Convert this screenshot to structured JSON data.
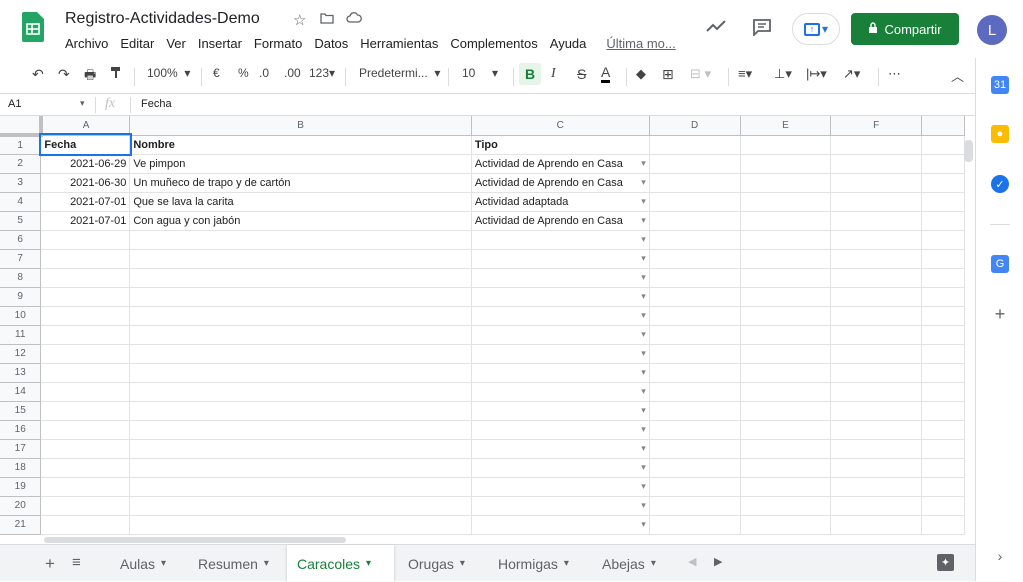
{
  "header": {
    "title": "Registro-Actividades-Demo",
    "menu": [
      "Archivo",
      "Editar",
      "Ver",
      "Insertar",
      "Formato",
      "Datos",
      "Herramientas",
      "Complementos",
      "Ayuda"
    ],
    "last_edit": "Última mo...",
    "share_label": "Compartir",
    "avatar_letter": "L",
    "brand_color": "#188038"
  },
  "toolbar": {
    "zoom": "100%",
    "currency": "€",
    "percent": "%",
    "decimal_less": ".0",
    "decimal_more": ".00",
    "more_formats": "123",
    "font": "Predetermi...",
    "font_size": "10",
    "bold": "B",
    "italic": "I",
    "strike": "S",
    "text_color": "A",
    "more": "⋯"
  },
  "formula_bar": {
    "cell_ref": "A1",
    "fx": "fx",
    "content": "Fecha"
  },
  "columns": [
    "A",
    "B",
    "C",
    "D",
    "E",
    "F"
  ],
  "rows": [
    {
      "n": "1",
      "a": "Fecha",
      "b": "Nombre",
      "c": "Tipo"
    },
    {
      "n": "2",
      "a": "2021-06-29",
      "b": "Ve pimpon",
      "c": "Actividad de Aprendo en Casa"
    },
    {
      "n": "3",
      "a": "2021-06-30",
      "b": "Un muñeco de trapo y de cartón",
      "c": "Actividad de Aprendo en Casa"
    },
    {
      "n": "4",
      "a": "2021-07-01",
      "b": "Que se lava la carita",
      "c": "Actividad adaptada"
    },
    {
      "n": "5",
      "a": "2021-07-01",
      "b": "Con agua y con jabón",
      "c": "Actividad de Aprendo en Casa"
    },
    {
      "n": "6",
      "a": "",
      "b": "",
      "c": ""
    },
    {
      "n": "7",
      "a": "",
      "b": "",
      "c": ""
    },
    {
      "n": "8",
      "a": "",
      "b": "",
      "c": ""
    },
    {
      "n": "9",
      "a": "",
      "b": "",
      "c": ""
    },
    {
      "n": "10",
      "a": "",
      "b": "",
      "c": ""
    },
    {
      "n": "11",
      "a": "",
      "b": "",
      "c": ""
    },
    {
      "n": "12",
      "a": "",
      "b": "",
      "c": ""
    },
    {
      "n": "13",
      "a": "",
      "b": "",
      "c": ""
    },
    {
      "n": "14",
      "a": "",
      "b": "",
      "c": ""
    },
    {
      "n": "15",
      "a": "",
      "b": "",
      "c": ""
    },
    {
      "n": "16",
      "a": "",
      "b": "",
      "c": ""
    },
    {
      "n": "17",
      "a": "",
      "b": "",
      "c": ""
    },
    {
      "n": "18",
      "a": "",
      "b": "",
      "c": ""
    },
    {
      "n": "19",
      "a": "",
      "b": "",
      "c": ""
    },
    {
      "n": "20",
      "a": "",
      "b": "",
      "c": ""
    },
    {
      "n": "21",
      "a": "",
      "b": "",
      "c": ""
    }
  ],
  "sheets": {
    "tabs": [
      "Aulas",
      "Resumen",
      "Caracoles",
      "Orugas",
      "Hormigas",
      "Abejas"
    ],
    "active": "Caracoles"
  },
  "side_icons": [
    "calendar-icon",
    "keep-icon",
    "tasks-icon",
    "contacts-icon",
    "add-icon"
  ]
}
